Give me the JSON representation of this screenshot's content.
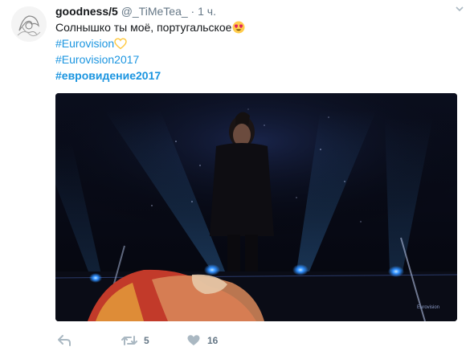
{
  "tweet": {
    "author_name": "goodness/5",
    "author_handle": "@_TiMeTea_",
    "separator": "·",
    "timestamp": "1 ч.",
    "text": "Солнышко ты моё, португальское",
    "hashtags": [
      "#Eurovision",
      "#Eurovision2017",
      "#евровидение2017"
    ],
    "media": {
      "watermark": "Eurovision"
    },
    "actions": {
      "reply_icon": "reply-arrow-icon",
      "retweet_icon": "retweet-icon",
      "retweet_count": "5",
      "like_icon": "heart-icon",
      "like_count": "16"
    }
  },
  "colors": {
    "link": "#1b95e0",
    "muted": "#657786",
    "text": "#14171a",
    "heart_outline": "#ffc83d"
  }
}
